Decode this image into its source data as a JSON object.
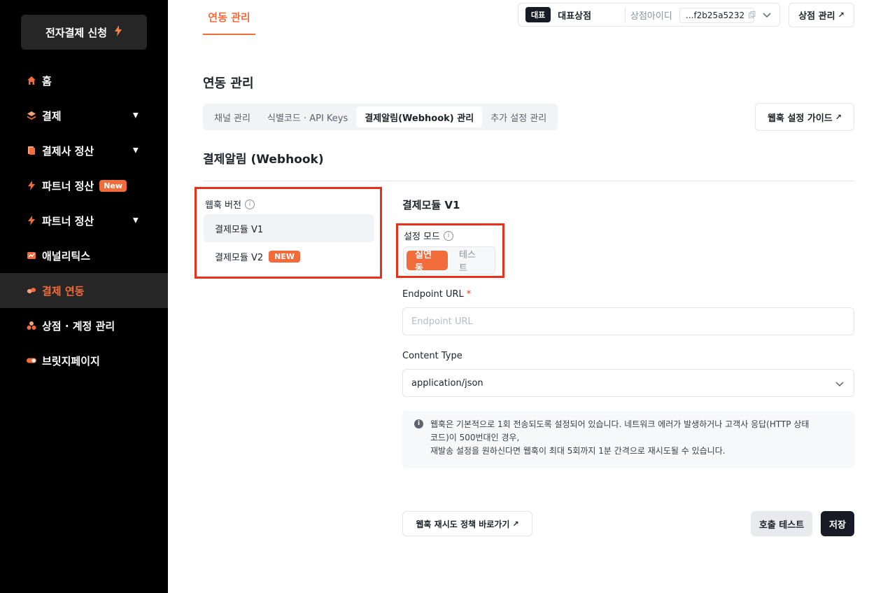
{
  "sidebar": {
    "apply_button": "전자결제 신청",
    "apply_icon": "bolt-icon",
    "items": [
      {
        "label": "홈",
        "icon": "home-icon",
        "has_caret": false,
        "badge": ""
      },
      {
        "label": "결제",
        "icon": "layers-icon",
        "has_caret": true,
        "badge": ""
      },
      {
        "label": "결제사 정산",
        "icon": "document-icon",
        "has_caret": true,
        "badge": ""
      },
      {
        "label": "파트너 정산",
        "icon": "bolt-icon",
        "has_caret": false,
        "badge": "New"
      },
      {
        "label": "파트너 정산",
        "icon": "bolt-icon",
        "has_caret": true,
        "badge": ""
      },
      {
        "label": "애널리틱스",
        "icon": "chart-icon",
        "has_caret": false,
        "badge": ""
      },
      {
        "label": "결제 연동",
        "icon": "link-icon",
        "has_caret": false,
        "badge": "",
        "active": true
      },
      {
        "label": "상점 · 계정 관리",
        "icon": "users-icon",
        "has_caret": false,
        "badge": ""
      },
      {
        "label": "브릿지페이지",
        "icon": "toggle-icon",
        "has_caret": false,
        "badge": ""
      }
    ]
  },
  "topbar": {
    "active_tab": "연동 관리",
    "store_tag": "대표",
    "store_name": "대표상점",
    "store_id_label": "상점아이디",
    "store_id_value": "...f2b25a5232",
    "store_manage": "상점 관리"
  },
  "page": {
    "title": "연동 관리",
    "subtabs": [
      "채널 관리",
      "식별코드 · API Keys",
      "결제알림(Webhook) 관리",
      "추가 설정 관리"
    ],
    "active_subtab": 2,
    "guide_button": "웹훅 설정 가이드",
    "section_title": "결제알림 (Webhook)"
  },
  "version": {
    "label": "웹훅 버전",
    "items": [
      {
        "label": "결제모듈 V1",
        "badge": "",
        "selected": true
      },
      {
        "label": "결제모듈 V2",
        "badge": "NEW",
        "selected": false
      }
    ]
  },
  "config": {
    "module_title": "결제모듈 V1",
    "mode_label": "설정 모드",
    "mode_options": [
      "실연동",
      "테스트"
    ],
    "mode_active": 0,
    "endpoint_label": "Endpoint URL",
    "endpoint_required": "*",
    "endpoint_placeholder": "Endpoint URL",
    "endpoint_value": "",
    "content_type_label": "Content Type",
    "content_type_value": "application/json",
    "info_lines": [
      "웹훅은 기본적으로 1회 전송되도록 설정되어 있습니다. 네트워크 에러가 발생하거나 고객사 응답(HTTP 상태",
      "코드)이 500번대인 경우,",
      "재발송 설정을 원하신다면 웹훅이 최대 5회까지 1분 간격으로 재시도될 수 있습니다."
    ]
  },
  "actions": {
    "retry_policy": "웹훅 재시도 정책 바로가기",
    "call_test": "호출 테스트",
    "save": "저장"
  },
  "colors": {
    "accent": "#f26b3a",
    "highlight_border": "#e8301a",
    "sidebar_bg": "#000000",
    "dark_button": "#161b26"
  }
}
